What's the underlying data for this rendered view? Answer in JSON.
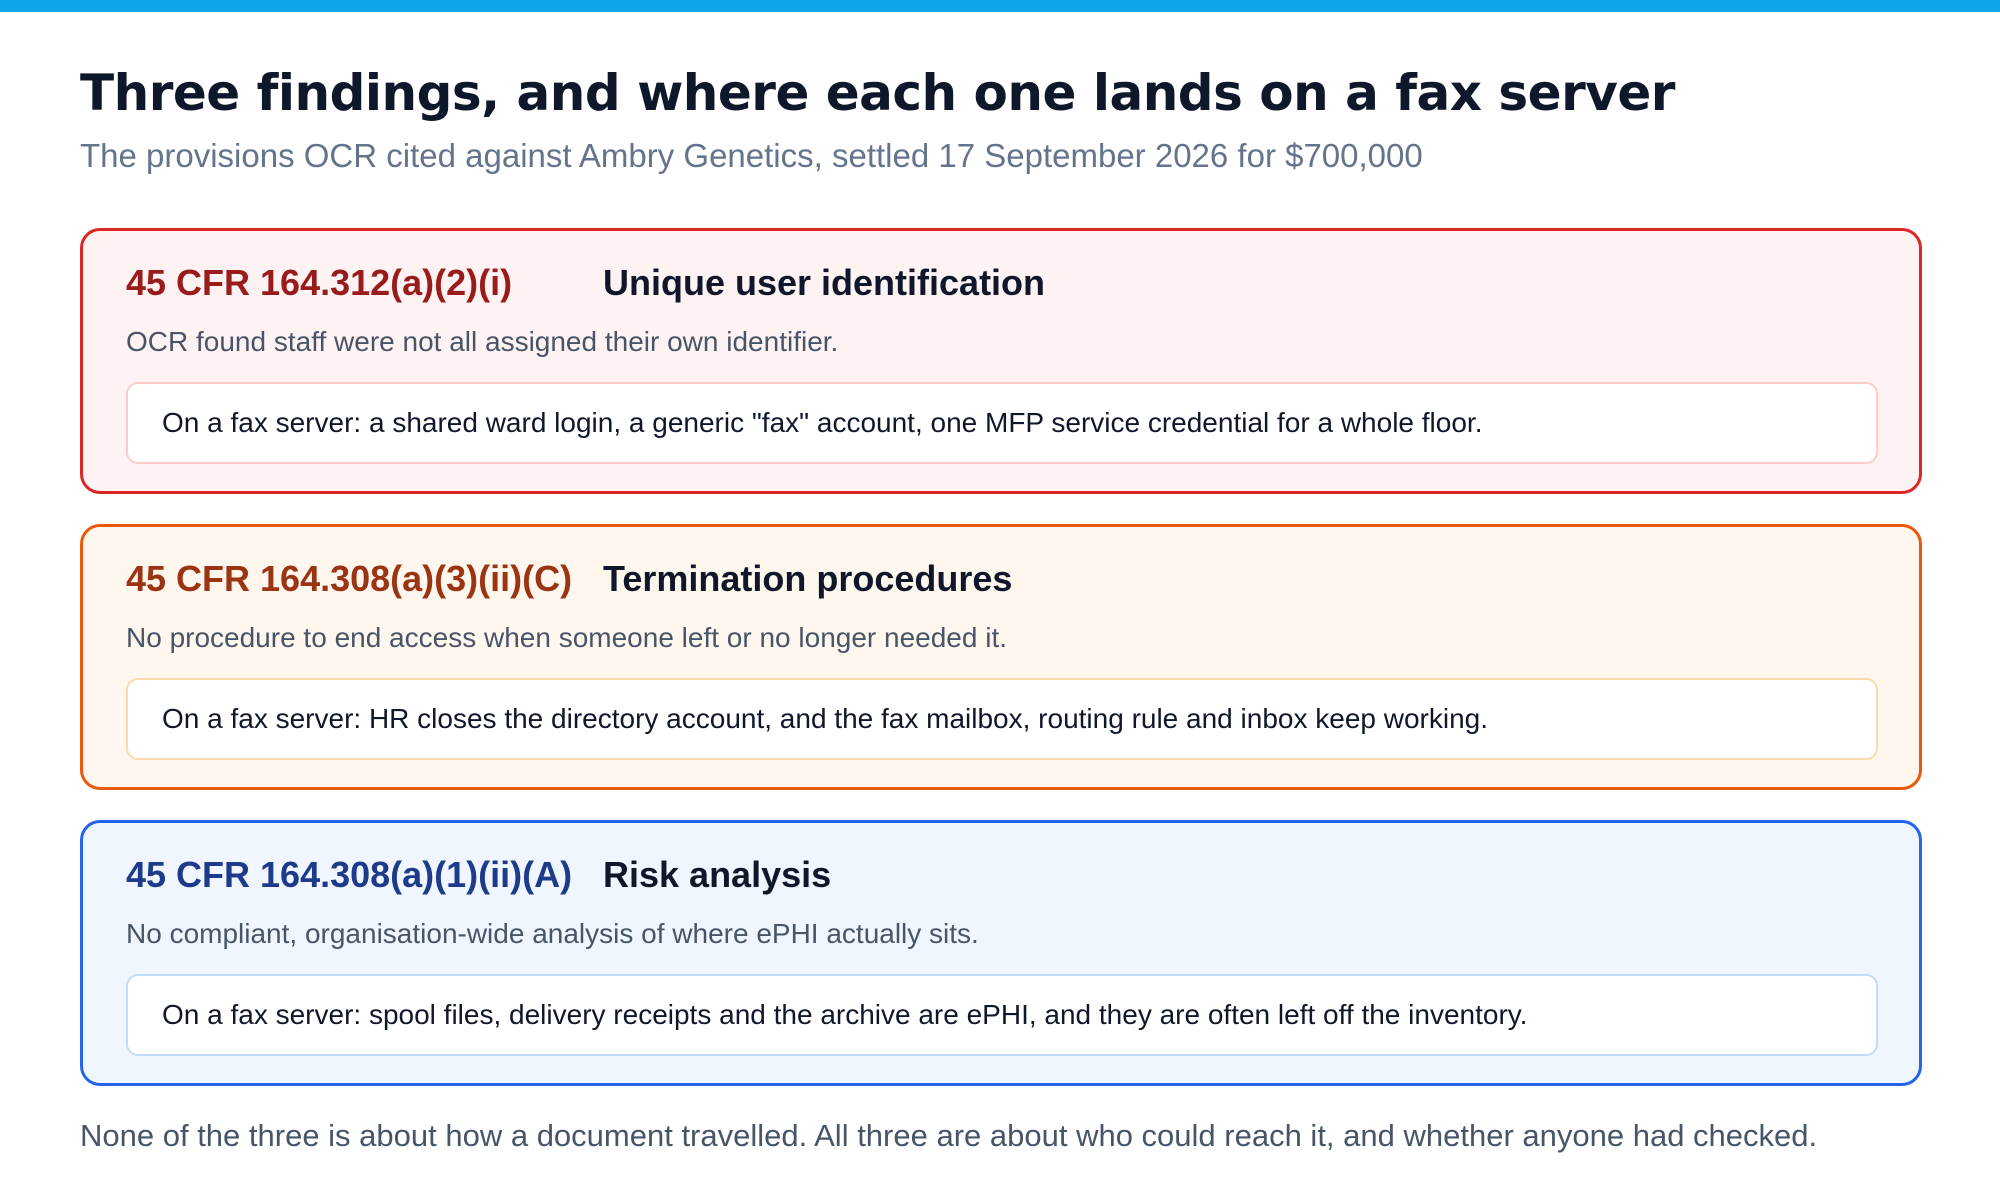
{
  "page": {
    "title": "Three findings, and where each one lands on a fax server",
    "subtitle": "The provisions OCR cited against Ambry Genetics, settled 17 September 2026 for $700,000",
    "accent_bar_color": "#0ea5e9"
  },
  "findings": [
    {
      "citation": "45 CFR 164.312(a)(2)(i)",
      "heading": "Unique user identification",
      "finding": "OCR found staff were not all assigned their own identifier.",
      "example": "On a fax server: a shared ward login, a generic \"fax\" account, one MFP service credential for a whole floor.",
      "border_color": "#dc2626",
      "background_color": "#fef2f2"
    },
    {
      "citation": "45 CFR 164.308(a)(3)(ii)(C)",
      "heading": "Termination procedures",
      "finding": "No procedure to end access when someone left or no longer needed it.",
      "example": "On a fax server: HR closes the directory account, and the fax mailbox, routing rule and inbox keep working.",
      "border_color": "#ea580c",
      "background_color": "#fff7ed"
    },
    {
      "citation": "45 CFR 164.308(a)(1)(ii)(A)",
      "heading": "Risk analysis",
      "finding": "No compliant, organisation-wide analysis of where ePHI actually sits.",
      "example": "On a fax server: spool files, delivery receipts and the archive are ePHI, and they are often left off the inventory.",
      "border_color": "#2563eb",
      "background_color": "#eff6ff"
    }
  ],
  "footer": {
    "text": "None of the three is about how a document travelled. All three are about who could reach it, and whether anyone had checked."
  }
}
